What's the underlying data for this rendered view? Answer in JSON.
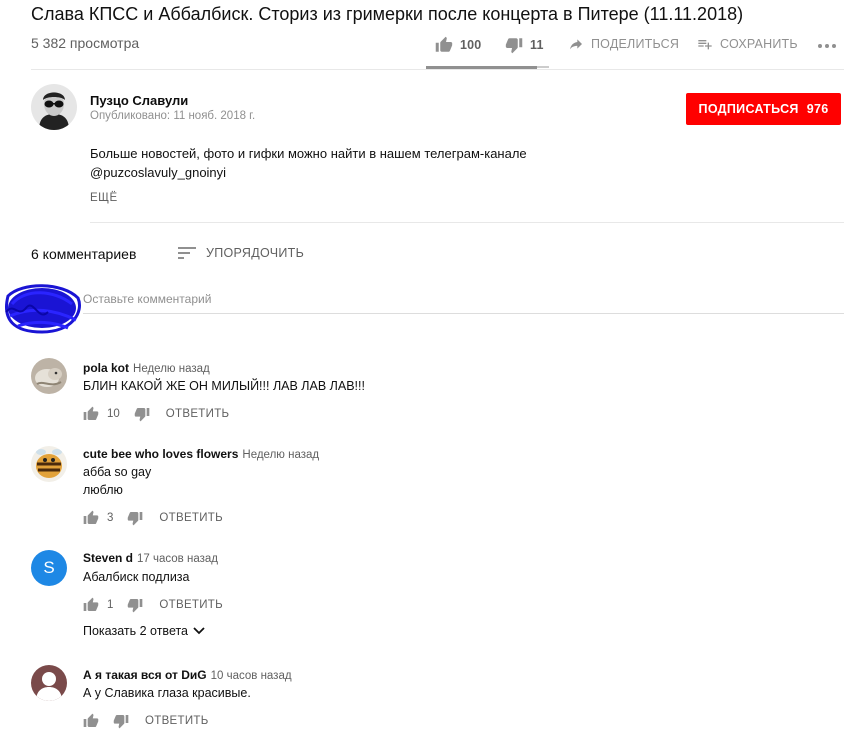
{
  "video": {
    "title": "Слава КПСС и Аббалбиск. Сториз из гримерки после концерта в Питере (11.11.2018)",
    "views": "5 382 просмотра",
    "likes": "100",
    "dislikes": "11",
    "share_label": "ПОДЕЛИТЬСЯ",
    "save_label": "СОХРАНИТЬ",
    "like_ratio": 0.9
  },
  "channel": {
    "name": "Пузцо Славули",
    "published": "Опубликовано: 11 нояб. 2018 г.",
    "subscribe_label": "ПОДПИСАТЬСЯ",
    "subscribers": "976"
  },
  "description": {
    "line1": "Больше новостей, фото и гифки можно найти в нашем телеграм-канале",
    "line2": "@puzcoslavuly_gnoinyi",
    "more_label": "ЕЩЁ"
  },
  "comments_section": {
    "count_label": "6 комментариев",
    "sort_label": "УПОРЯДОЧИТЬ",
    "input_placeholder": "Оставьте комментарий",
    "reply_label": "ОТВЕТИТЬ",
    "show_replies_label": "Показать 2 ответа"
  },
  "comments": [
    {
      "author": "pola kot",
      "time": "Неделю назад",
      "lines": [
        "БЛИН КАКОЙ ЖЕ ОН МИЛЫЙ!!! ЛАВ ЛАВ ЛАВ!!!"
      ],
      "likes": "10"
    },
    {
      "author": "cute bee who loves flowers",
      "time": "Неделю назад",
      "lines": [
        "абба so gay",
        "люблю"
      ],
      "likes": "3"
    },
    {
      "author": "Steven d",
      "time": "17 часов назад",
      "lines": [
        "Абалбиск подлиза"
      ],
      "likes": "1",
      "avatar_letter": "S",
      "avatar_color": "#1e88e5"
    },
    {
      "author": "А я такая вся от DиG",
      "time": "10 часов назад",
      "lines": [
        "А у Славика глаза красивые."
      ],
      "likes": ""
    }
  ],
  "colors": {
    "subscribe": "#ff0000",
    "scribble": "#1010d8"
  }
}
